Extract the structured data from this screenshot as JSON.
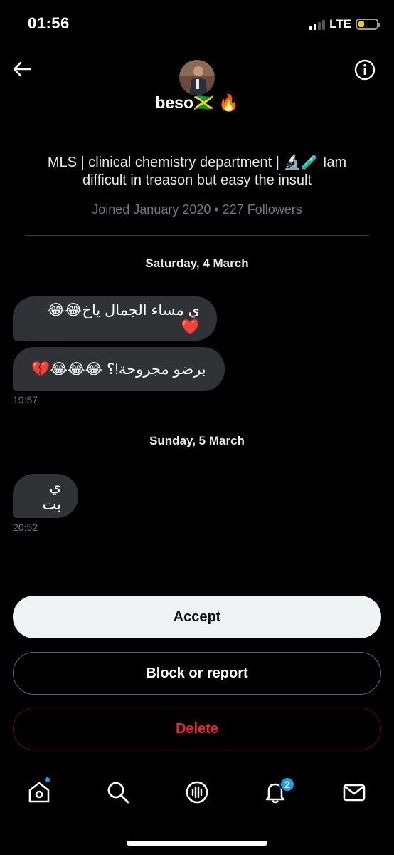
{
  "status_bar": {
    "time": "01:56",
    "network": "LTE",
    "battery_level": 0.25
  },
  "header": {
    "name": "beso🇯🇲 🔥",
    "bio": "MLS | clinical chemistry department | 🔬🧪 Iam difficult in treason but easy the insult",
    "joined": "Joined January 2020 • 227 Followers"
  },
  "conversation": {
    "dates": [
      "Saturday, 4 March",
      "Sunday, 5 March"
    ],
    "messages": [
      {
        "text": "ي مساء الجمال ياخ😂😂❤️"
      },
      {
        "text": "برضو مجروحة!؟ 😂😂😂💔",
        "time": "19:57"
      },
      {
        "text": "ي بت",
        "time": "20:52"
      }
    ]
  },
  "actions": {
    "accept": "Accept",
    "block": "Block or report",
    "delete": "Delete"
  },
  "tabbar": {
    "notifications_count": "2"
  },
  "colors": {
    "accent": "#1d9bf0",
    "danger": "#f4212e",
    "bubble": "#2f3336"
  }
}
